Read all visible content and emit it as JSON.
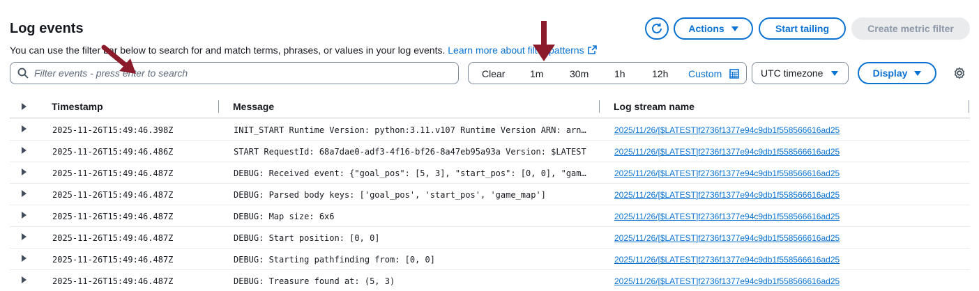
{
  "header": {
    "title": "Log events",
    "description": "You can use the filter bar below to search for and match terms, phrases, or values in your log events.",
    "learn_more": "Learn more about filter patterns"
  },
  "toolbar": {
    "actions_label": "Actions",
    "start_tailing_label": "Start tailing",
    "create_metric_filter_label": "Create metric filter",
    "display_label": "Display"
  },
  "search": {
    "placeholder": "Filter events - press enter to search"
  },
  "time_range": {
    "clear": "Clear",
    "options": [
      "1m",
      "30m",
      "1h",
      "12h"
    ],
    "custom": "Custom"
  },
  "timezone": {
    "selected": "UTC timezone"
  },
  "table": {
    "columns": [
      "Timestamp",
      "Message",
      "Log stream name"
    ],
    "rows": [
      {
        "timestamp": "2025-11-26T15:49:46.398Z",
        "message": "INIT_START Runtime Version: python:3.11.v107 Runtime Version ARN: arn:aws:lambda",
        "stream": "2025/11/26/[$LATEST]f2736f1377e94c9db1f558566616ad25"
      },
      {
        "timestamp": "2025-11-26T15:49:46.486Z",
        "message": "START RequestId: 68a7dae0-adf3-4f16-bf26-8a47eb95a93a Version: $LATEST",
        "stream": "2025/11/26/[$LATEST]f2736f1377e94c9db1f558566616ad25"
      },
      {
        "timestamp": "2025-11-26T15:49:46.487Z",
        "message": "DEBUG: Received event: {\"goal_pos\": [5, 3], \"start_pos\": [0, 0], \"game_map\"",
        "stream": "2025/11/26/[$LATEST]f2736f1377e94c9db1f558566616ad25"
      },
      {
        "timestamp": "2025-11-26T15:49:46.487Z",
        "message": "DEBUG: Parsed body keys: ['goal_pos', 'start_pos', 'game_map']",
        "stream": "2025/11/26/[$LATEST]f2736f1377e94c9db1f558566616ad25"
      },
      {
        "timestamp": "2025-11-26T15:49:46.487Z",
        "message": "DEBUG: Map size: 6x6",
        "stream": "2025/11/26/[$LATEST]f2736f1377e94c9db1f558566616ad25"
      },
      {
        "timestamp": "2025-11-26T15:49:46.487Z",
        "message": "DEBUG: Start position: [0, 0]",
        "stream": "2025/11/26/[$LATEST]f2736f1377e94c9db1f558566616ad25"
      },
      {
        "timestamp": "2025-11-26T15:49:46.487Z",
        "message": "DEBUG: Starting pathfinding from: [0, 0]",
        "stream": "2025/11/26/[$LATEST]f2736f1377e94c9db1f558566616ad25"
      },
      {
        "timestamp": "2025-11-26T15:49:46.487Z",
        "message": "DEBUG: Treasure found at: (5, 3)",
        "stream": "2025/11/26/[$LATEST]f2736f1377e94c9db1f558566616ad25"
      }
    ]
  },
  "colors": {
    "accent": "#0972d3",
    "annotation_arrow": "#8b1a2b",
    "disabled_bg": "#e9ebed"
  },
  "icons": [
    "refresh-icon",
    "search-icon",
    "calendar-icon",
    "gear-icon",
    "external-link-icon",
    "expand-caret-icon"
  ]
}
